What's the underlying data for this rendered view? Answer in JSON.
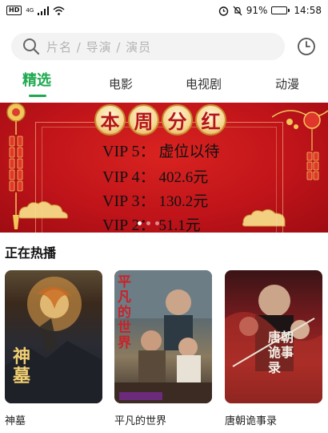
{
  "status_bar": {
    "left_badge": "HD",
    "network": "4G",
    "battery": "91%",
    "battery_level": 0.91,
    "time": "14:58"
  },
  "search": {
    "placeholder": "片名 / 导演 / 演员",
    "search_icon": "search-icon",
    "history_icon": "clock-icon"
  },
  "tabs": [
    {
      "label": "精选",
      "active": true
    },
    {
      "label": "电影",
      "active": false
    },
    {
      "label": "电视剧",
      "active": false
    },
    {
      "label": "动漫",
      "active": false
    }
  ],
  "banner": {
    "title_chars": [
      "本",
      "周",
      "分",
      "红"
    ],
    "lines": [
      {
        "label": "VIP 5：",
        "value": "虚位以待"
      },
      {
        "label": "VIP 4：",
        "value": "402.6元"
      },
      {
        "label": "VIP 3：",
        "value": "130.2元"
      },
      {
        "label": "VIP 2：",
        "value": "51.1元"
      }
    ],
    "pages": 3,
    "active_page": 0,
    "colors": {
      "background": "#c0141a",
      "gold": "#f6d690"
    }
  },
  "section": {
    "title": "正在热播",
    "items": [
      {
        "title": "神墓",
        "poster_text": "神墓"
      },
      {
        "title": "平凡的世界",
        "poster_text": "平凡的世界"
      },
      {
        "title": "唐朝诡事录",
        "poster_text": "唐朝诡事录"
      }
    ]
  },
  "accent_color": "#1ea94f"
}
